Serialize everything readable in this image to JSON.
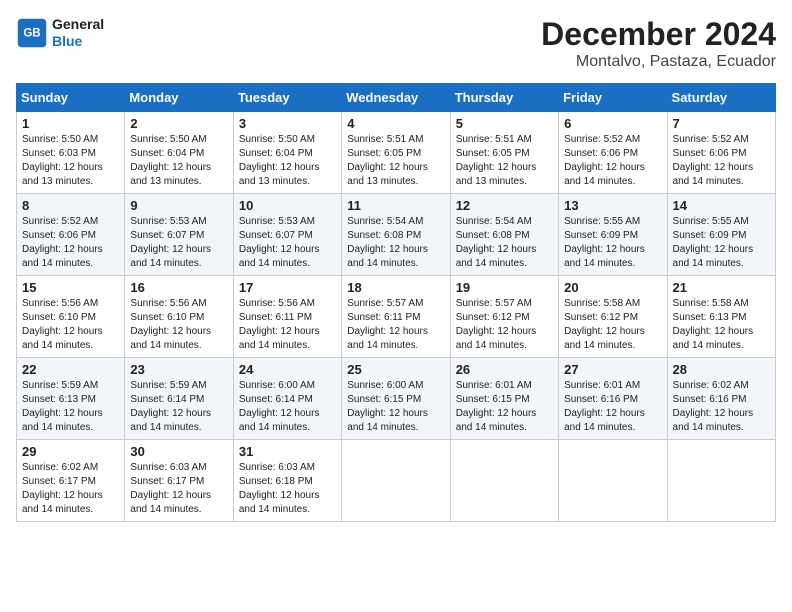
{
  "header": {
    "logo_line1": "General",
    "logo_line2": "Blue",
    "title": "December 2024",
    "subtitle": "Montalvo, Pastaza, Ecuador"
  },
  "days_of_week": [
    "Sunday",
    "Monday",
    "Tuesday",
    "Wednesday",
    "Thursday",
    "Friday",
    "Saturday"
  ],
  "weeks": [
    [
      {
        "day": "1",
        "info": "Sunrise: 5:50 AM\nSunset: 6:03 PM\nDaylight: 12 hours\nand 13 minutes."
      },
      {
        "day": "2",
        "info": "Sunrise: 5:50 AM\nSunset: 6:04 PM\nDaylight: 12 hours\nand 13 minutes."
      },
      {
        "day": "3",
        "info": "Sunrise: 5:50 AM\nSunset: 6:04 PM\nDaylight: 12 hours\nand 13 minutes."
      },
      {
        "day": "4",
        "info": "Sunrise: 5:51 AM\nSunset: 6:05 PM\nDaylight: 12 hours\nand 13 minutes."
      },
      {
        "day": "5",
        "info": "Sunrise: 5:51 AM\nSunset: 6:05 PM\nDaylight: 12 hours\nand 13 minutes."
      },
      {
        "day": "6",
        "info": "Sunrise: 5:52 AM\nSunset: 6:06 PM\nDaylight: 12 hours\nand 14 minutes."
      },
      {
        "day": "7",
        "info": "Sunrise: 5:52 AM\nSunset: 6:06 PM\nDaylight: 12 hours\nand 14 minutes."
      }
    ],
    [
      {
        "day": "8",
        "info": "Sunrise: 5:52 AM\nSunset: 6:06 PM\nDaylight: 12 hours\nand 14 minutes."
      },
      {
        "day": "9",
        "info": "Sunrise: 5:53 AM\nSunset: 6:07 PM\nDaylight: 12 hours\nand 14 minutes."
      },
      {
        "day": "10",
        "info": "Sunrise: 5:53 AM\nSunset: 6:07 PM\nDaylight: 12 hours\nand 14 minutes."
      },
      {
        "day": "11",
        "info": "Sunrise: 5:54 AM\nSunset: 6:08 PM\nDaylight: 12 hours\nand 14 minutes."
      },
      {
        "day": "12",
        "info": "Sunrise: 5:54 AM\nSunset: 6:08 PM\nDaylight: 12 hours\nand 14 minutes."
      },
      {
        "day": "13",
        "info": "Sunrise: 5:55 AM\nSunset: 6:09 PM\nDaylight: 12 hours\nand 14 minutes."
      },
      {
        "day": "14",
        "info": "Sunrise: 5:55 AM\nSunset: 6:09 PM\nDaylight: 12 hours\nand 14 minutes."
      }
    ],
    [
      {
        "day": "15",
        "info": "Sunrise: 5:56 AM\nSunset: 6:10 PM\nDaylight: 12 hours\nand 14 minutes."
      },
      {
        "day": "16",
        "info": "Sunrise: 5:56 AM\nSunset: 6:10 PM\nDaylight: 12 hours\nand 14 minutes."
      },
      {
        "day": "17",
        "info": "Sunrise: 5:56 AM\nSunset: 6:11 PM\nDaylight: 12 hours\nand 14 minutes."
      },
      {
        "day": "18",
        "info": "Sunrise: 5:57 AM\nSunset: 6:11 PM\nDaylight: 12 hours\nand 14 minutes."
      },
      {
        "day": "19",
        "info": "Sunrise: 5:57 AM\nSunset: 6:12 PM\nDaylight: 12 hours\nand 14 minutes."
      },
      {
        "day": "20",
        "info": "Sunrise: 5:58 AM\nSunset: 6:12 PM\nDaylight: 12 hours\nand 14 minutes."
      },
      {
        "day": "21",
        "info": "Sunrise: 5:58 AM\nSunset: 6:13 PM\nDaylight: 12 hours\nand 14 minutes."
      }
    ],
    [
      {
        "day": "22",
        "info": "Sunrise: 5:59 AM\nSunset: 6:13 PM\nDaylight: 12 hours\nand 14 minutes."
      },
      {
        "day": "23",
        "info": "Sunrise: 5:59 AM\nSunset: 6:14 PM\nDaylight: 12 hours\nand 14 minutes."
      },
      {
        "day": "24",
        "info": "Sunrise: 6:00 AM\nSunset: 6:14 PM\nDaylight: 12 hours\nand 14 minutes."
      },
      {
        "day": "25",
        "info": "Sunrise: 6:00 AM\nSunset: 6:15 PM\nDaylight: 12 hours\nand 14 minutes."
      },
      {
        "day": "26",
        "info": "Sunrise: 6:01 AM\nSunset: 6:15 PM\nDaylight: 12 hours\nand 14 minutes."
      },
      {
        "day": "27",
        "info": "Sunrise: 6:01 AM\nSunset: 6:16 PM\nDaylight: 12 hours\nand 14 minutes."
      },
      {
        "day": "28",
        "info": "Sunrise: 6:02 AM\nSunset: 6:16 PM\nDaylight: 12 hours\nand 14 minutes."
      }
    ],
    [
      {
        "day": "29",
        "info": "Sunrise: 6:02 AM\nSunset: 6:17 PM\nDaylight: 12 hours\nand 14 minutes."
      },
      {
        "day": "30",
        "info": "Sunrise: 6:03 AM\nSunset: 6:17 PM\nDaylight: 12 hours\nand 14 minutes."
      },
      {
        "day": "31",
        "info": "Sunrise: 6:03 AM\nSunset: 6:18 PM\nDaylight: 12 hours\nand 14 minutes."
      },
      null,
      null,
      null,
      null
    ]
  ]
}
